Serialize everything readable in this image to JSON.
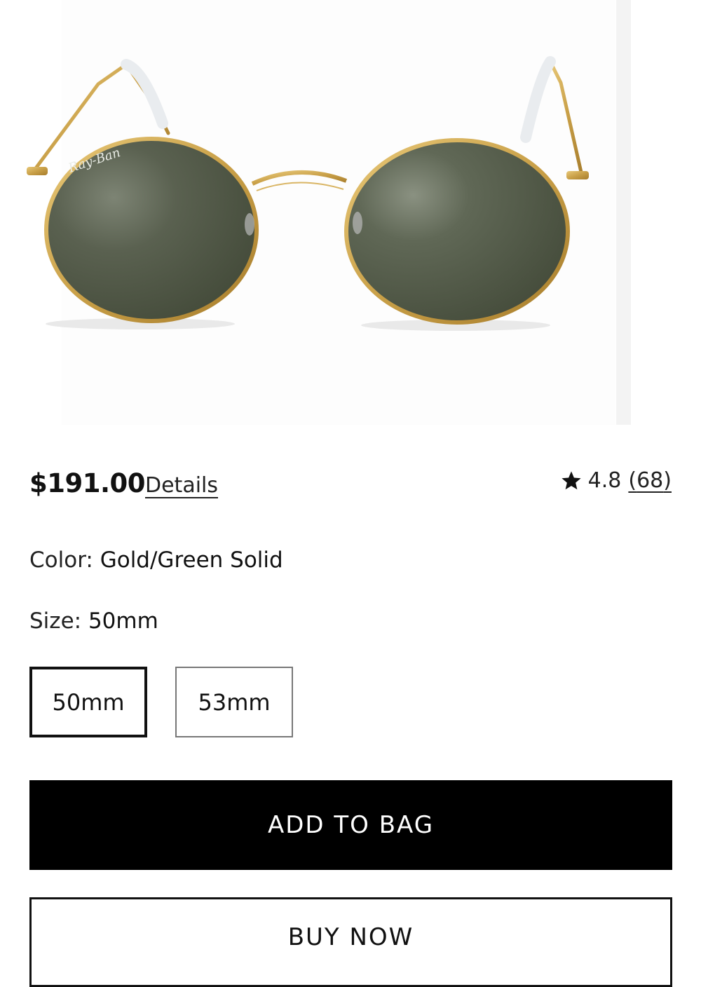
{
  "product": {
    "image_alt": "Ray-Ban round metal sunglasses, gold frame with green lenses",
    "brand_mark": "Ray-Ban",
    "price": "$191.00",
    "details_label": "Details",
    "rating": {
      "value": "4.8",
      "count": "68",
      "open_paren": "(",
      "close_paren": ")",
      "icon": "star-icon"
    },
    "color": {
      "label": "Color: ",
      "value": "Gold/Green Solid"
    },
    "size": {
      "label": "Size: ",
      "value": "50mm",
      "options": [
        {
          "label": "50mm",
          "selected": true
        },
        {
          "label": "53mm",
          "selected": false
        }
      ]
    }
  },
  "actions": {
    "add_to_bag": "ADD TO BAG",
    "buy_now": "BUY NOW"
  },
  "colors": {
    "frame_gold": "#c9a048",
    "lens_green": "#4a5142",
    "primary_button": "#000000"
  }
}
